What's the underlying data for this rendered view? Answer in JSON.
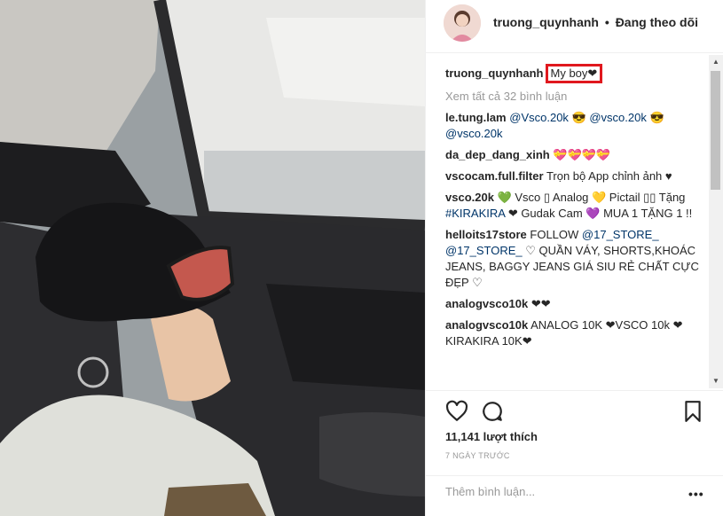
{
  "post": {
    "username": "truong_quynhanh",
    "separator": "•",
    "follow_status": "Đang theo dõi"
  },
  "caption": {
    "username": "truong_quynhanh",
    "text": "My boy❤"
  },
  "view_all": "Xem tất cả 32 bình luận",
  "comments": [
    {
      "user": "le.tung.lam",
      "parts": [
        {
          "t": "@Vsco.20k",
          "m": true
        },
        {
          "t": " 😎 ",
          "m": false
        },
        {
          "t": "@vsco.20k",
          "m": true
        },
        {
          "t": " 😎 ",
          "m": false
        },
        {
          "t": "@vsco.20k",
          "m": true
        }
      ]
    },
    {
      "user": "da_dep_dang_xinh",
      "parts": [
        {
          "t": "💝💝💝💝",
          "m": false
        }
      ]
    },
    {
      "user": "vscocam.full.filter",
      "parts": [
        {
          "t": "Trọn bộ App chỉnh ảnh ♥",
          "m": false
        }
      ]
    },
    {
      "user": "vsco.20k",
      "parts": [
        {
          "t": "💚 Vsco ▯ Analog 💛 Pictail ▯▯ Tặng ",
          "m": false
        },
        {
          "t": "#KIRAKIRA",
          "m": true
        },
        {
          "t": " ❤ Gudak Cam 💜 MUA 1 TẶNG 1 !!",
          "m": false
        }
      ]
    },
    {
      "user": "helloits17store",
      "parts": [
        {
          "t": "FOLLOW ",
          "m": false
        },
        {
          "t": "@17_STORE_",
          "m": true
        },
        {
          "t": " ",
          "m": false
        },
        {
          "t": "@17_STORE_",
          "m": true
        },
        {
          "t": " ♡ QUẦN VÁY, SHORTS,KHOÁC JEANS, BAGGY JEANS GIÁ SIU RẺ CHẤT CỰC ĐẸP ♡",
          "m": false
        }
      ]
    },
    {
      "user": "analogvsco10k",
      "parts": [
        {
          "t": "❤❤",
          "m": false
        }
      ]
    },
    {
      "user": "analogvsco10k",
      "parts": [
        {
          "t": "ANALOG 10K ❤VSCO 10k ❤KIRAKIRA 10K❤",
          "m": false
        }
      ]
    }
  ],
  "actions": {
    "like_icon": "heart-icon",
    "comment_icon": "comment-icon",
    "save_icon": "bookmark-icon"
  },
  "likes": "11,141 lượt thích",
  "time": "7 NGÀY TRƯỚC",
  "add_comment": {
    "placeholder": "Thêm bình luận...",
    "more_icon": "more-options-icon"
  },
  "scrollbar": {
    "up": "▲",
    "down": "▼"
  }
}
